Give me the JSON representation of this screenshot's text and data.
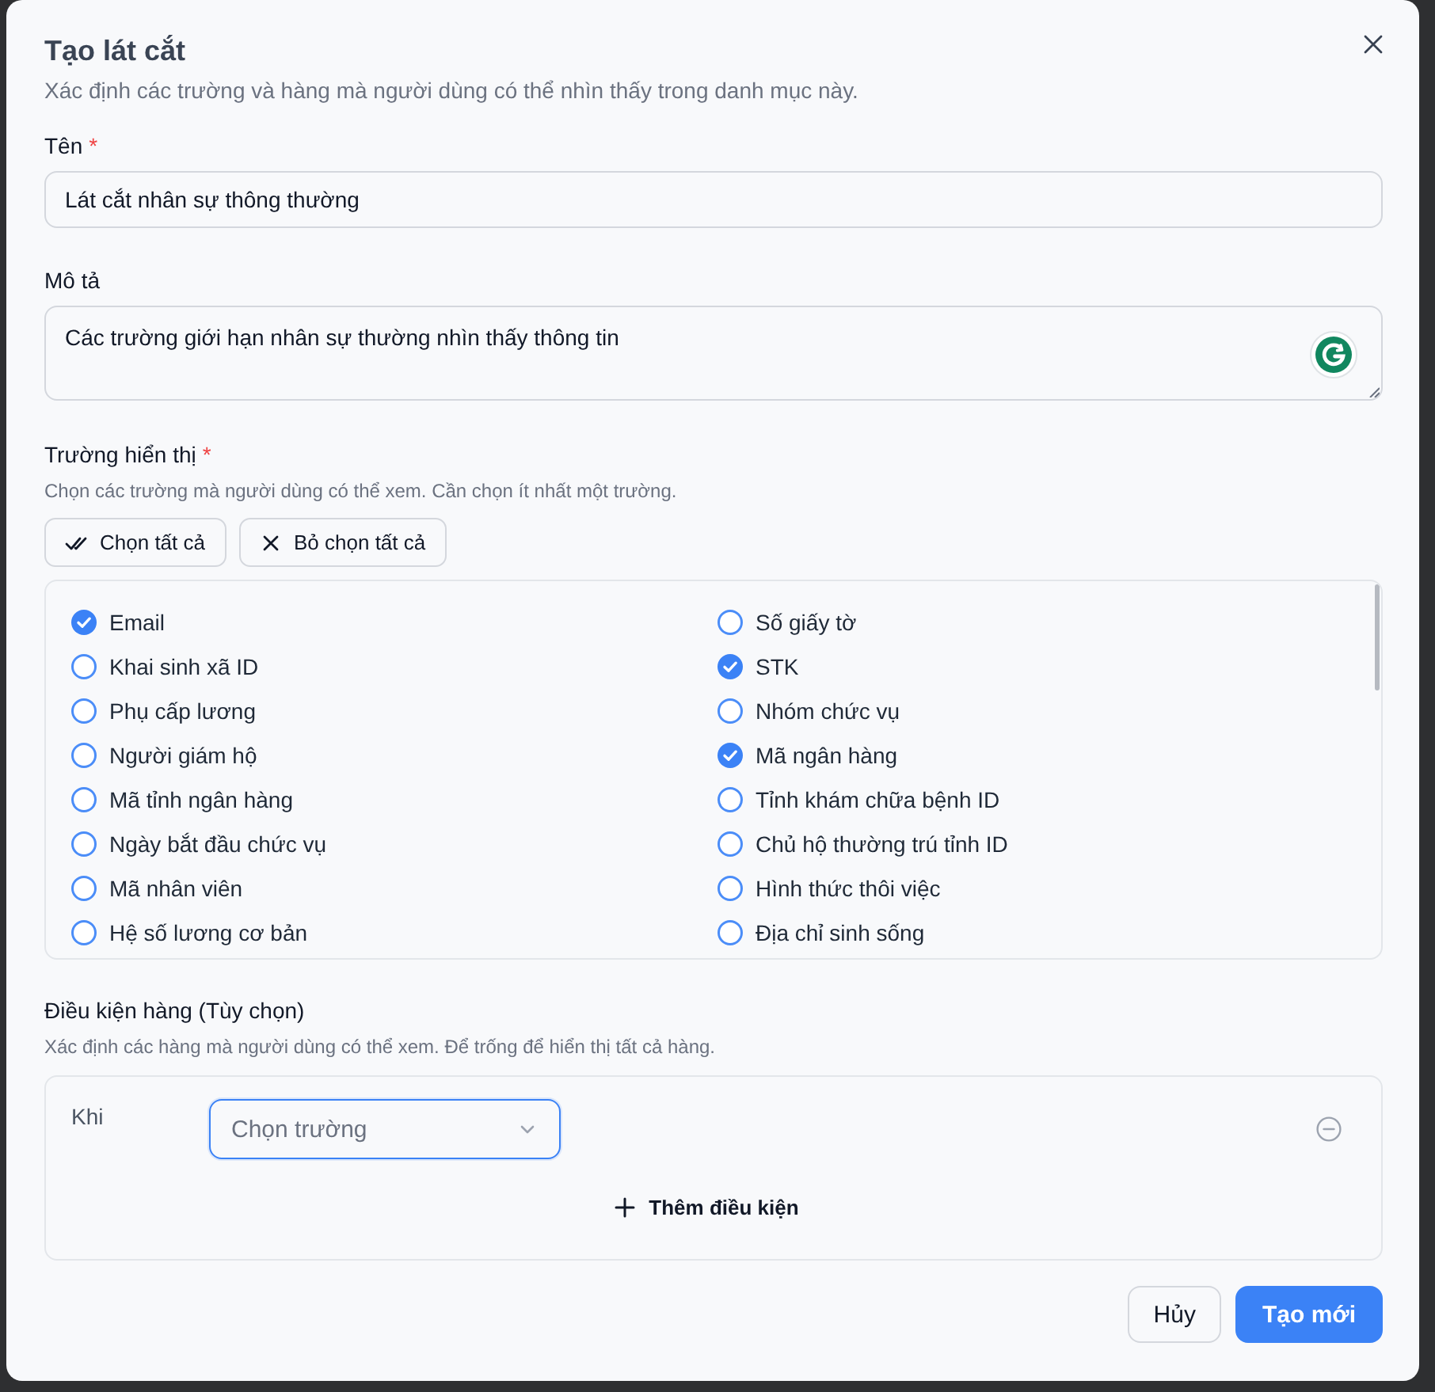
{
  "dialog": {
    "title": "Tạo lát cắt",
    "description": "Xác định các trường và hàng mà người dùng có thể nhìn thấy trong danh mục này."
  },
  "name_field": {
    "label": "Tên",
    "required_mark": "*",
    "value": "Lát cắt nhân sự thông thường"
  },
  "description_field": {
    "label": "Mô tả",
    "value": "Các trường giới hạn nhân sự thường nhìn thấy thông tin"
  },
  "visible_fields": {
    "label": "Trường hiển thị",
    "required_mark": "*",
    "hint": "Chọn các trường mà người dùng có thể xem. Cần chọn ít nhất một trường.",
    "actions": [
      {
        "kind": "select_all",
        "label": "Chọn tất cả"
      },
      {
        "kind": "clear_all",
        "label": "Bỏ chọn tất cả"
      }
    ],
    "options": [
      {
        "label": "Email",
        "checked": true
      },
      {
        "label": "Số giấy tờ",
        "checked": false
      },
      {
        "label": "Khai sinh xã ID",
        "checked": false
      },
      {
        "label": "STK",
        "checked": true
      },
      {
        "label": "Phụ cấp lương",
        "checked": false
      },
      {
        "label": "Nhóm chức vụ",
        "checked": false
      },
      {
        "label": "Người giám hộ",
        "checked": false
      },
      {
        "label": "Mã ngân hàng",
        "checked": true
      },
      {
        "label": "Mã tỉnh ngân hàng",
        "checked": false
      },
      {
        "label": "Tỉnh khám chữa bệnh ID",
        "checked": false
      },
      {
        "label": "Ngày bắt đầu chức vụ",
        "checked": false
      },
      {
        "label": "Chủ hộ thường trú tỉnh ID",
        "checked": false
      },
      {
        "label": "Mã nhân viên",
        "checked": false
      },
      {
        "label": "Hình thức thôi việc",
        "checked": false
      },
      {
        "label": "Hệ số lương cơ bản",
        "checked": false
      },
      {
        "label": "Địa chỉ sinh sống",
        "checked": false
      }
    ]
  },
  "row_conditions": {
    "label": "Điều kiện hàng (Tùy chọn)",
    "hint": "Xác định các hàng mà người dùng có thể xem. Để trống để hiển thị tất cả hàng.",
    "conditions": [
      {
        "label": "Khi",
        "placeholder": "Chọn trường"
      }
    ],
    "add_button": "Thêm điều kiện"
  },
  "footer": {
    "buttons": [
      {
        "kind": "secondary",
        "label": "Hủy"
      },
      {
        "kind": "primary",
        "label": "Tạo mới"
      }
    ]
  }
}
